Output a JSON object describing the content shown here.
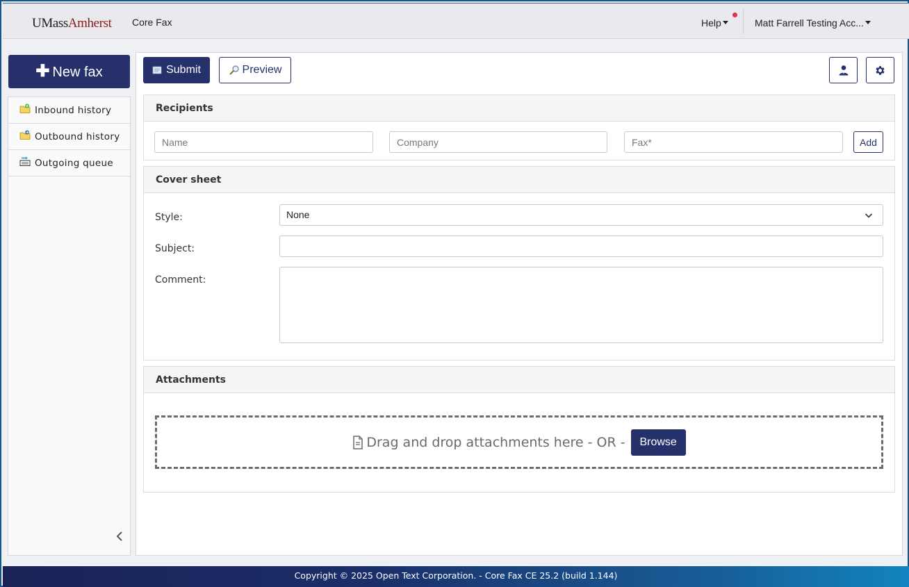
{
  "header": {
    "logo_um": "UMass",
    "logo_amherst": "Amherst",
    "app_name": "Core Fax",
    "help_label": "Help",
    "user_label": "Matt Farrell Testing Acc..."
  },
  "sidebar": {
    "new_fax_label": "New fax",
    "items": [
      {
        "label": "Inbound history",
        "icon": "folder-inbound-icon"
      },
      {
        "label": "Outbound history",
        "icon": "folder-outbound-icon"
      },
      {
        "label": "Outgoing queue",
        "icon": "outbox-queue-icon"
      }
    ]
  },
  "toolbar": {
    "submit_label": "Submit",
    "preview_label": "Preview"
  },
  "recipients": {
    "title": "Recipients",
    "name_placeholder": "Name",
    "company_placeholder": "Company",
    "fax_placeholder": "Fax*",
    "add_label": "Add"
  },
  "cover_sheet": {
    "title": "Cover sheet",
    "style_label": "Style:",
    "style_value": "None",
    "subject_label": "Subject:",
    "subject_value": "",
    "comment_label": "Comment:",
    "comment_value": ""
  },
  "attachments": {
    "title": "Attachments",
    "dropzone_text": "Drag and drop attachments here - OR -",
    "browse_label": "Browse"
  },
  "footer": {
    "text": "Copyright © 2025 Open Text Corporation. - Core Fax CE 25.2 (build 1.144)"
  },
  "colors": {
    "primary": "#26306b",
    "notification": "#d9384a",
    "logo_red": "#8a1c1c"
  }
}
